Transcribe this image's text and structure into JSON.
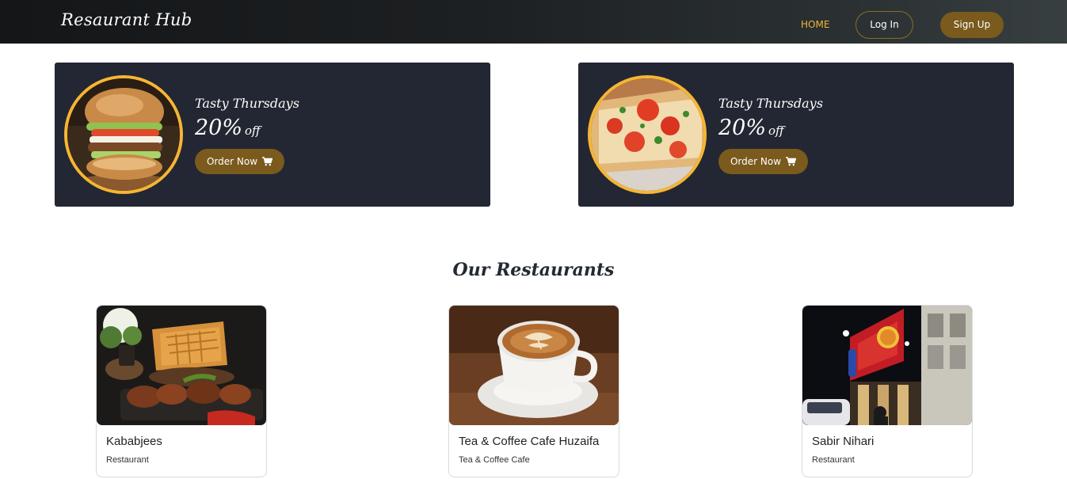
{
  "navbar": {
    "brand": "Resaurant Hub",
    "links": {
      "home": "HOME",
      "login": "Log In",
      "signup": "Sign Up"
    }
  },
  "promos": [
    {
      "title": "Tasty Thursdays",
      "discount": "20%",
      "discount_suffix": "off",
      "button": "Order Now",
      "image": "burger-image",
      "icon": "cart-icon"
    },
    {
      "title": "Tasty Thursdays",
      "discount": "20%",
      "discount_suffix": "off",
      "button": "Order Now",
      "image": "pizza-image",
      "icon": "cart-icon"
    }
  ],
  "restaurants_section": {
    "title": "Our Restaurants",
    "cards": [
      {
        "name": "Kababjees",
        "type": "Restaurant",
        "image": "grilled-food-image"
      },
      {
        "name": "Tea & Coffee Cafe Huzaifa",
        "type": "Tea & Coffee Cafe",
        "image": "coffee-cup-image"
      },
      {
        "name": "Sabir Nihari",
        "type": "Restaurant",
        "image": "restaurant-storefront-image"
      }
    ]
  },
  "colors": {
    "accent": "#f6b534",
    "button_brown": "#7a5a1d",
    "promo_bg": "#232733",
    "nav_active": "#f0b43a"
  }
}
